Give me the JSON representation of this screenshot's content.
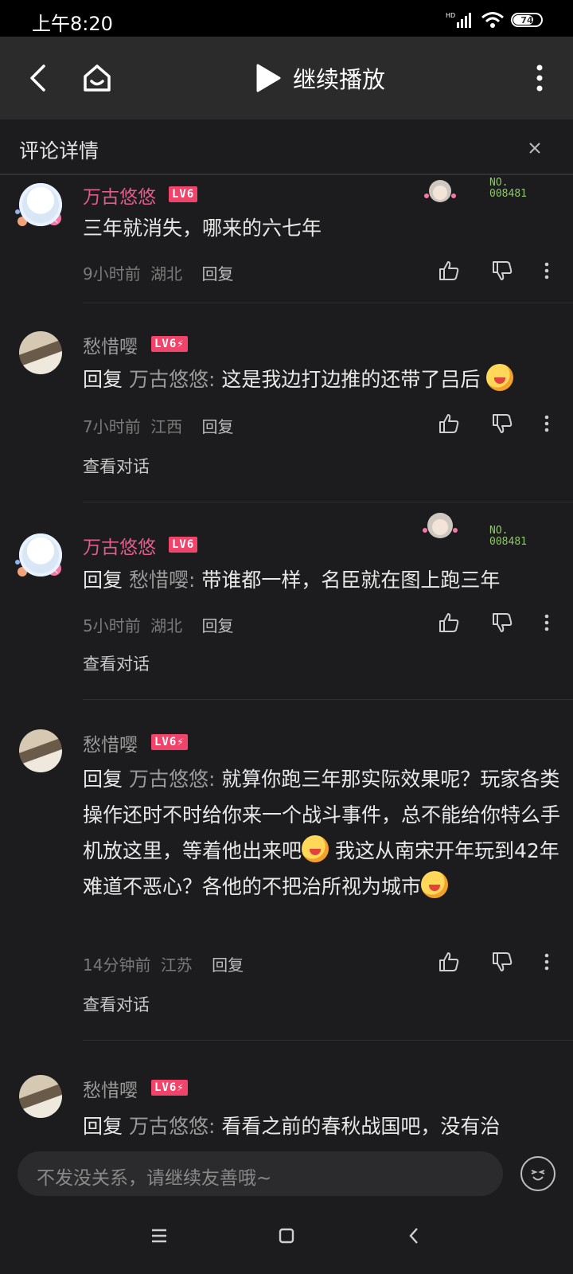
{
  "status_bar": {
    "time": "上午8:20",
    "battery": "74"
  },
  "nav": {
    "play_label": "继续播放"
  },
  "panel": {
    "title": "评论详情"
  },
  "comments": [
    {
      "user": "万古悠悠",
      "level": "LV6",
      "text": "三年就消失，哪来的六七年",
      "time": "9小时前",
      "location": "湖北",
      "reply": "回复",
      "fan_no": "NO.\n008481"
    },
    {
      "user": "愁惜嘤",
      "level": "LV6⚡",
      "reply_prefix": "回复 ",
      "quote": "万古悠悠:",
      "text": " 这是我边打边推的还带了吕后",
      "time": "7小时前",
      "location": "江西",
      "reply": "回复",
      "view": "查看对话"
    },
    {
      "user": "万古悠悠",
      "level": "LV6",
      "reply_prefix": "回复 ",
      "quote": "愁惜嘤:",
      "text": " 带谁都一样，名臣就在图上跑三年",
      "time": "5小时前",
      "location": "湖北",
      "reply": "回复",
      "view": "查看对话",
      "fan_no": "NO.\n008481"
    },
    {
      "user": "愁惜嘤",
      "level": "LV6⚡",
      "reply_prefix": "回复 ",
      "quote": "万古悠悠:",
      "text1": " 就算你跑三年那实际效果呢？玩家各类操作还时不时给你来一个战斗事件，总不能给你特么手机放这里，等着他出来吧",
      "text2": " 我这从南宋开年玩到42年难道不恶心？各他的不把治所视为城市",
      "time": "14分钟前",
      "location": "江苏",
      "reply": "回复",
      "view": "查看对话"
    },
    {
      "user": "愁惜嘤",
      "level": "LV6⚡",
      "reply_prefix": "回复 ",
      "quote": "万古悠悠:",
      "text": " 看看之前的春秋战国吧，没有治"
    }
  ],
  "input": {
    "placeholder": "不发没关系，请继续友善哦~"
  },
  "colors": {
    "accent_pink": "#e05c8a",
    "badge_red": "#f0446a",
    "fan_green": "#8ec76b"
  }
}
